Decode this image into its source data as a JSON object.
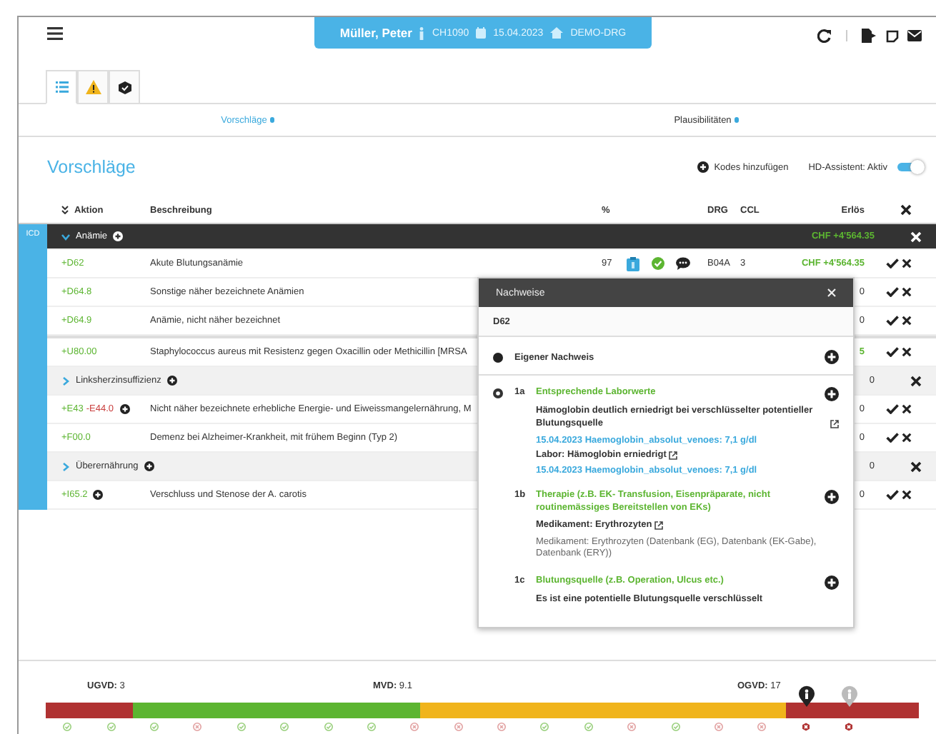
{
  "header": {
    "patient": {
      "name": "Müller, Peter",
      "id": "CH1090",
      "date": "15.04.2023",
      "case": "DEMO-DRG"
    }
  },
  "view_tabs": [
    {
      "kind": "list",
      "selected": true
    },
    {
      "kind": "warning",
      "selected": false
    },
    {
      "kind": "shield",
      "selected": false
    }
  ],
  "section_tabs": [
    {
      "label": "Vorschläge",
      "selected": true
    },
    {
      "label": "Plausibilitäten",
      "selected": false
    }
  ],
  "title": "Vorschläge",
  "add_codes": "Kodes hinzufügen",
  "assistant": {
    "label": "HD-Assistent: Aktiv",
    "on": true
  },
  "table": {
    "columns": [
      "Aktion",
      "Beschreibung",
      "%",
      "DRG",
      "CCL",
      "Erlös"
    ],
    "side_label": "ICD",
    "rows": [
      {
        "kind": "group",
        "label": "Anämie",
        "expanded": true,
        "selected": true,
        "erloes": "CHF +4'564.35"
      },
      {
        "kind": "code",
        "code": "+D62",
        "description": "Akute Blutungsanämie",
        "percent": "97",
        "indicators": [
          {
            "kind": "document"
          },
          {
            "kind": "verified"
          },
          {
            "kind": "comment"
          }
        ],
        "drg": "B04A",
        "ccl": "3",
        "erloes": "CHF +4'564.35"
      },
      {
        "kind": "code",
        "code": "+D64.8",
        "description": "Sonstige näher bezeichnete Anämien",
        "erloes": "0"
      },
      {
        "kind": "code",
        "code": "+D64.9",
        "description": "Anämie, nicht näher bezeichnet",
        "erloes": "0"
      },
      {
        "kind": "code",
        "code": "+U80.00",
        "separated": true,
        "description": "Staphylococcus aureus mit Resistenz gegen Oxacillin oder Methicillin [MRSA",
        "erloes": "5",
        "positive": true
      },
      {
        "kind": "group",
        "label": "Linksherzinsuffizienz",
        "expanded": false,
        "selected": false,
        "erloes": "0"
      },
      {
        "kind": "code",
        "code": "+E43",
        "removed_code": "-E44.0",
        "details": true,
        "description": "Nicht näher bezeichnete erhebliche Energie- und Eiweissmangelernährung, M",
        "erloes": "0"
      },
      {
        "kind": "code",
        "code": "+F00.0",
        "description": "Demenz bei Alzheimer-Krankheit, mit frühem Beginn (Typ 2)",
        "erloes": "0"
      },
      {
        "kind": "group",
        "label": "Überernährung",
        "expanded": false,
        "selected": false,
        "erloes": "0"
      },
      {
        "kind": "code",
        "code": "+I65.2",
        "details": true,
        "description": "Verschluss und Stenose der A. carotis",
        "erloes": "0"
      }
    ]
  },
  "evidence_popup": {
    "title": "Nachweise",
    "code": "D62",
    "sections": [
      {
        "kind": "own",
        "label": "Eigener Nachweis"
      },
      {
        "kind": "criteria",
        "items": [
          {
            "index": "1a",
            "title": "Entsprechende Laborwerte",
            "entries": [
              {
                "label": "Hämoglobin deutlich erniedrigt bei verschlüsselter potentieller Blutungsquelle",
                "external": true,
                "detail": {
                  "kind": "lab",
                  "text": "15.04.2023 Haemoglobin_absolut_venoes: 7,1 g/dl"
                }
              },
              {
                "label": "Labor: Hämoglobin erniedrigt",
                "external": true,
                "detail": {
                  "kind": "lab",
                  "text": "15.04.2023 Haemoglobin_absolut_venoes: 7,1 g/dl"
                }
              }
            ]
          },
          {
            "index": "1b",
            "title": "Therapie (z.B. EK- Transfusion, Eisenpräparate, nicht routinemässiges Bereitstellen von EKs)",
            "entries": [
              {
                "label": "Medikament: Erythrozyten",
                "external": true,
                "detail": {
                  "kind": "note",
                  "text": "Medikament: Erythrozyten (Datenbank (EG), Datenbank (EK-Gabe), Datenbank (ERY))"
                }
              }
            ]
          },
          {
            "index": "1c",
            "title": "Blutungsquelle (z.B. Operation, Ulcus etc.)",
            "entries": [
              {
                "label": "Es ist eine potentielle Blutungsquelle verschlüsselt",
                "external": false
              }
            ]
          }
        ]
      }
    ]
  },
  "stay_scale": {
    "labels": [
      {
        "key": "UGVD:",
        "value": "3"
      },
      {
        "key": "MVD:",
        "value": "9.1"
      },
      {
        "key": "OGVD:",
        "value": "17"
      }
    ],
    "segments": [
      {
        "color": "#b03232"
      },
      {
        "color": "#5cb531"
      },
      {
        "color": "#f0b41c"
      },
      {
        "color": "#b03232"
      }
    ],
    "days": [
      {
        "kind": "ok"
      },
      {
        "kind": "ok"
      },
      {
        "kind": "ok"
      },
      {
        "kind": "warn"
      },
      {
        "kind": "ok"
      },
      {
        "kind": "ok"
      },
      {
        "kind": "ok"
      },
      {
        "kind": "ok"
      },
      {
        "kind": "warn"
      },
      {
        "kind": "warn"
      },
      {
        "kind": "warn"
      },
      {
        "kind": "ok"
      },
      {
        "kind": "ok"
      },
      {
        "kind": "warn"
      },
      {
        "kind": "ok"
      },
      {
        "kind": "warn"
      },
      {
        "kind": "warn"
      },
      {
        "kind": "over",
        "pin": {
          "kind": "current"
        }
      },
      {
        "kind": "over",
        "pin": {
          "kind": "planned"
        }
      }
    ]
  }
}
